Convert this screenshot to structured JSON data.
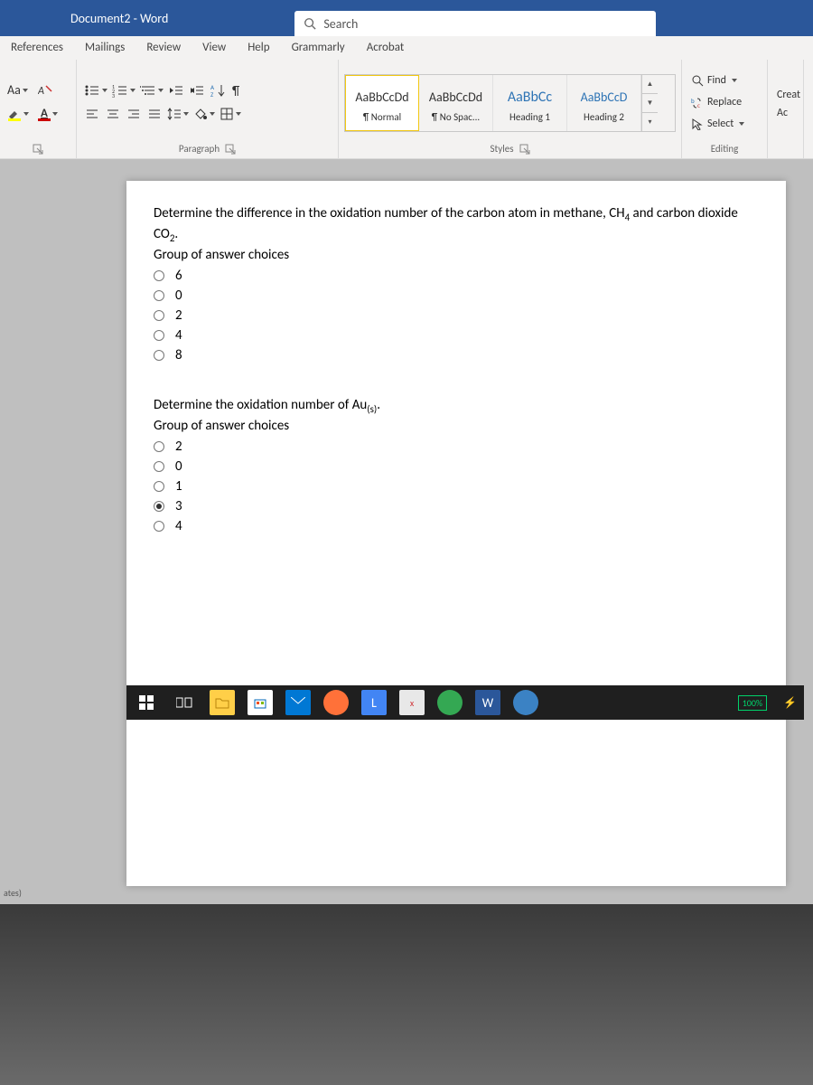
{
  "title": "Document2 - Word",
  "search_placeholder": "Search",
  "tabs": [
    "References",
    "Mailings",
    "Review",
    "View",
    "Help",
    "Grammarly",
    "Acrobat"
  ],
  "font_group": {
    "case_btn": "Aa",
    "clear_btn": "A"
  },
  "paragraph_group": {
    "label": "Paragraph"
  },
  "styles_group": {
    "label": "Styles",
    "items": [
      {
        "preview": "AaBbCcDd",
        "name": "¶ Normal",
        "cls": ""
      },
      {
        "preview": "AaBbCcDd",
        "name": "¶ No Spac...",
        "cls": ""
      },
      {
        "preview": "AaBbCc",
        "name": "Heading 1",
        "cls": "h1"
      },
      {
        "preview": "AaBbCcD",
        "name": "Heading 2",
        "cls": "h2"
      }
    ]
  },
  "editing_group": {
    "label": "Editing",
    "find": "Find",
    "replace": "Replace",
    "select": "Select"
  },
  "partial": {
    "a": "Creat",
    "b": "Ac"
  },
  "doc": {
    "q1": {
      "text_a": "Determine the difference in the oxidation number of the carbon atom in methane, CH",
      "sub1": "4",
      "text_b": " and carbon dioxide CO",
      "sub2": "2",
      "text_c": ".",
      "group": "Group of answer choices",
      "choices": [
        "6",
        "0",
        "2",
        "4",
        "8"
      ],
      "selected": -1
    },
    "q2": {
      "text_a": "Determine the oxidation number of Au",
      "sub1": "(s)",
      "text_b": ".",
      "group": "Group of answer choices",
      "choices": [
        "2",
        "0",
        "1",
        "3",
        "4"
      ],
      "selected": 3
    }
  },
  "left_status": "ates)",
  "battery": "100%"
}
